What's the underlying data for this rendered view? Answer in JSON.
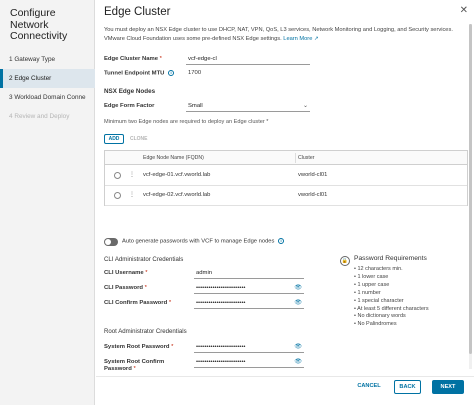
{
  "nav": {
    "title": "Configure Network Connectivity",
    "steps": [
      {
        "label": "1 Gateway Type"
      },
      {
        "label": "2 Edge Cluster"
      },
      {
        "label": "3 Workload Domain Conne"
      },
      {
        "label": "4 Review and Deploy"
      }
    ]
  },
  "header": {
    "title": "Edge Cluster",
    "close_icon": "close-icon"
  },
  "intro": {
    "text": "You must deploy an NSX Edge cluster to use DHCP, NAT, VPN, QoS, L3 services, Network Monitoring and Logging, and Security services. VMware Cloud Foundation uses some pre-defined NSX Edge settings.",
    "learn_more": "Learn More",
    "learn_more_icon": "external-link-icon"
  },
  "form": {
    "edge_cluster_name_label": "Edge Cluster Name",
    "edge_cluster_name_value": "vcf-edge-cl",
    "tunnel_mtu_label": "Tunnel Endpoint MTU",
    "tunnel_mtu_value": "1700",
    "required_marker": "*"
  },
  "edge_nodes": {
    "section_title": "NSX Edge Nodes",
    "form_factor_label": "Edge Form Factor",
    "form_factor_value": "Small",
    "note": "Minimum two Edge nodes are required to deploy an Edge cluster *",
    "add_label": "ADD",
    "clone_label": "CLONE",
    "columns": [
      "Edge Node Name (FQDN)",
      "Cluster"
    ],
    "rows": [
      {
        "name": "vcf-edge-01.vcf.vworld.lab",
        "cluster": "vworld-cl01"
      },
      {
        "name": "vcf-edge-02.vcf.vworld.lab",
        "cluster": "vworld-cl01"
      }
    ]
  },
  "auto_generate": {
    "label": "Auto generate passwords with VCF to manage Edge nodes",
    "enabled": false
  },
  "cli_creds": {
    "title": "CLI Administrator Credentials",
    "username_label": "CLI Username",
    "username_value": "admin",
    "password_label": "CLI Password",
    "password_value": "••••••••••••••••••••••••",
    "confirm_label": "CLI Confirm Password",
    "confirm_value": "••••••••••••••••••••••••"
  },
  "root_creds": {
    "title": "Root Administrator Credentials",
    "password_label": "System Root Password",
    "password_value": "••••••••••••••••••••••••",
    "confirm_label": "System Root Confirm",
    "confirm_label_2": "Password",
    "confirm_value": "••••••••••••••••••••••••"
  },
  "password_requirements": {
    "title": "Password Requirements",
    "items": [
      "12 characters min.",
      "1 lower case",
      "1 upper case",
      "1 number",
      "1 special character",
      "At least 5 different characters",
      "No dictionary words",
      "No Palindromes"
    ]
  },
  "footer": {
    "cancel": "CANCEL",
    "back": "BACK",
    "next": "NEXT"
  },
  "colors": {
    "accent": "#0072a3",
    "required": "#c21d00",
    "nav_bg": "#f3f3f3",
    "active_step_bg": "#dde6ed"
  }
}
